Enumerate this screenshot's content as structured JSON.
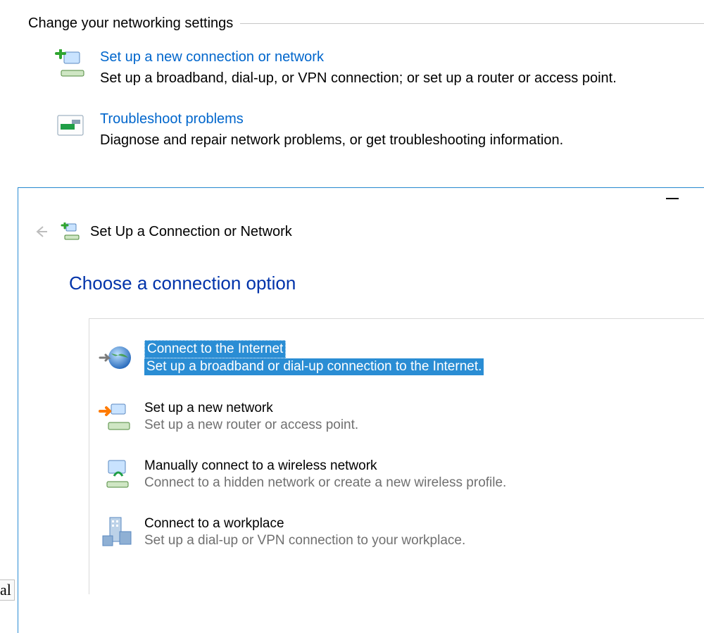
{
  "section_title": "Change your networking settings",
  "cp_items": [
    {
      "title": "Set up a new connection or network",
      "desc": "Set up a broadband, dial-up, or VPN connection; or set up a router or access point."
    },
    {
      "title": "Troubleshoot problems",
      "desc": "Diagnose and repair network problems, or get troubleshooting information."
    }
  ],
  "wizard": {
    "title": "Set Up a Connection or Network",
    "heading": "Choose a connection option",
    "options": [
      {
        "title": "Connect to the Internet",
        "desc": "Set up a broadband or dial-up connection to the Internet.",
        "selected": true
      },
      {
        "title": "Set up a new network",
        "desc": "Set up a new router or access point.",
        "selected": false
      },
      {
        "title": "Manually connect to a wireless network",
        "desc": "Connect to a hidden network or create a new wireless profile.",
        "selected": false
      },
      {
        "title": "Connect to a workplace",
        "desc": "Set up a dial-up or VPN connection to your workplace.",
        "selected": false
      }
    ]
  },
  "fragment_text": "al"
}
